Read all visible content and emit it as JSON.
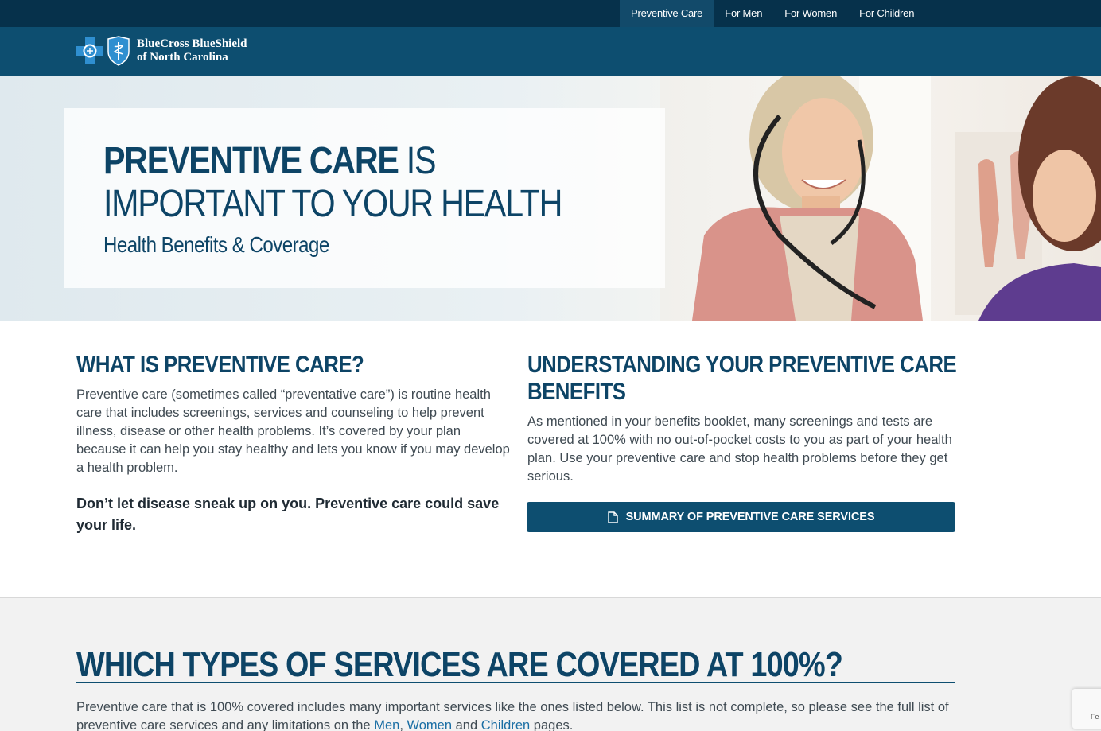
{
  "nav": {
    "items": [
      {
        "label": "Preventive Care",
        "active": true
      },
      {
        "label": "For Men",
        "active": false
      },
      {
        "label": "For Women",
        "active": false
      },
      {
        "label": "For Children",
        "active": false
      }
    ]
  },
  "brand": {
    "line1": "BlueCross BlueShield",
    "line2": "of North Carolina"
  },
  "hero": {
    "title_bold": "PREVENTIVE CARE",
    "title_rest": " IS",
    "title_line2": "IMPORTANT TO YOUR HEALTH",
    "subtitle": "Health Benefits & Coverage"
  },
  "left_col": {
    "heading": "WHAT IS PREVENTIVE CARE?",
    "body": "Preventive care (sometimes called “preventative care”) is routine health care that includes screenings, services and counseling to help prevent illness, disease or other health problems. It’s covered by your plan because it can help you stay healthy and lets you know if you may develop a health problem.",
    "callout": "Don’t let disease sneak up on you. Preventive care could save your life."
  },
  "right_col": {
    "heading_line1": "UNDERSTANDING YOUR PREVENTIVE CARE",
    "heading_line2": "BENEFITS",
    "body": "As mentioned in your benefits booklet, many screenings and tests are covered at 100% with no out-of-pocket costs to you as part of your health plan. Use your preventive care and stop health problems before they get serious.",
    "button_label": "SUMMARY OF PREVENTIVE CARE SERVICES"
  },
  "covered": {
    "heading": "WHICH TYPES OF SERVICES ARE COVERED AT 100%?",
    "body_before": "Preventive care that is 100% covered includes many important services like the ones listed below. This list is not complete, so please see the full list of preventive care services and any limitations on the ",
    "link_men": "Men",
    "sep1": ", ",
    "link_women": "Women",
    "sep2": " and ",
    "link_children": "Children",
    "body_after": " pages."
  },
  "recaptcha": {
    "label": "Fe"
  },
  "colors": {
    "navy": "#06314b",
    "brand_blue": "#0d4e70",
    "heading_blue": "#0d4466",
    "link_blue": "#1a6ea4"
  }
}
